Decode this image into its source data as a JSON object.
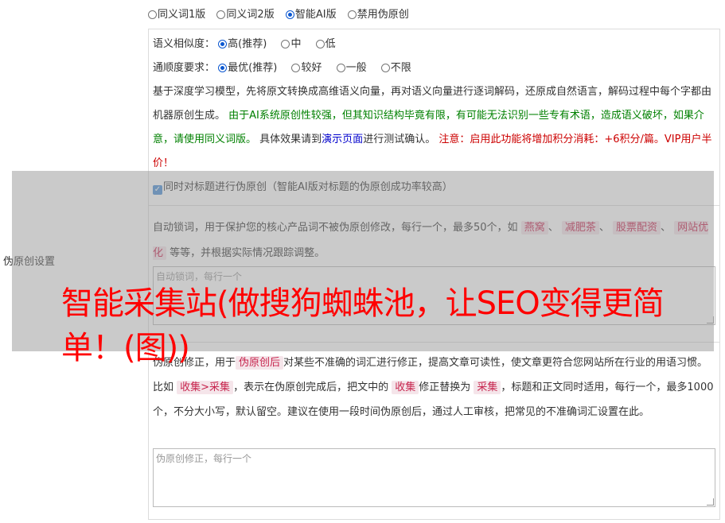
{
  "version_options": [
    {
      "label": "同义词1版",
      "selected": false
    },
    {
      "label": "同义词2版",
      "selected": false
    },
    {
      "label": "智能AI版",
      "selected": true
    },
    {
      "label": "禁用伪原创",
      "selected": false
    }
  ],
  "settings_label": "伪原创设置",
  "similarity": {
    "label": "语义相似度：",
    "options": [
      {
        "label": "高(推荐)",
        "selected": true
      },
      {
        "label": "中",
        "selected": false
      },
      {
        "label": "低",
        "selected": false
      }
    ]
  },
  "fluency": {
    "label": "通顺度要求：",
    "options": [
      {
        "label": "最优(推荐)",
        "selected": true
      },
      {
        "label": "较好",
        "selected": false
      },
      {
        "label": "一般",
        "selected": false
      },
      {
        "label": "不限",
        "selected": false
      }
    ]
  },
  "description": {
    "intro": "基于深度学习模型，先将原文转换成高维语义向量，再对语义向量进行逐词解码，还原成自然语言，解码过程中每个字都由机器原创生成。",
    "green_note": "由于AI系统原创性较强，但其知识结构毕竟有限，有可能无法识别一些专有术语，造成语义破坏，如果介意，请使用同义词版。",
    "test_prefix": "具体效果请到",
    "test_link": "演示页面",
    "test_suffix": "进行测试确认。",
    "red_note": "注意：启用此功能将增加积分消耗：+6积分/篇。VIP用户半价！"
  },
  "title_checkbox": {
    "label": "同时对标题进行伪原创（智能AI版对标题的伪原创成功率较高）",
    "checked": true
  },
  "lock_words": {
    "desc_prefix": "自动锁词，用于保护您的核心产品词不被伪原创修改，每行一个，最多50个，如",
    "examples": [
      "燕窝",
      "减肥茶",
      "股票配资",
      "网站优化"
    ],
    "desc_suffix": "等等，并根据实际情况跟踪调整。",
    "placeholder": "自动锁词，每行一个"
  },
  "correction": {
    "desc_prefix": "伪原创修正，用于",
    "tag1": "伪原创后",
    "desc_mid1": "对某些不准确的词汇进行修正，提高文章可读性，使文章更符合您网站所在行业的用语习惯。比如",
    "tag2": "收集>采集",
    "desc_mid2": "，表示在伪原创完成后，把文中的",
    "tag3": "收集",
    "desc_mid3": "修正替换为",
    "tag4": "采集",
    "desc_suffix": "，标题和正文同时适用，每行一个，最多1000个，不分大小写，默认留空。建议在使用一段时间伪原创后，通过人工审核，把常见的不准确词汇设置在此。",
    "placeholder": "伪原创修正，每行一个"
  },
  "watermark": "智能采集站(做搜狗蜘蛛池，让SEO变得更简单！(图))",
  "colors": {
    "selected_radio": "#0b57d0",
    "green_text": "#008000",
    "link_blue": "#0000cc",
    "warning_red": "#cc0000",
    "watermark_red": "#ff0000"
  }
}
